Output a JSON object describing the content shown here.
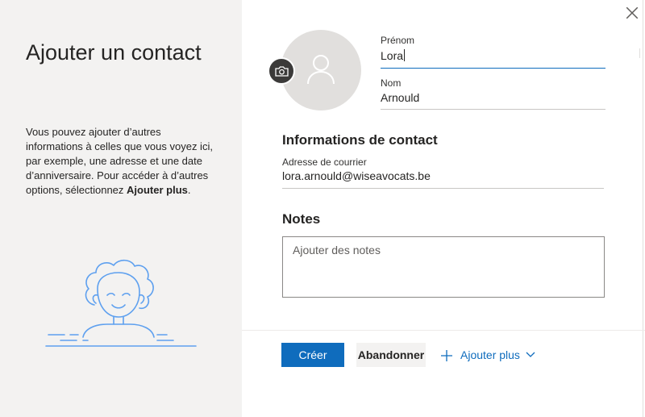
{
  "dialog": {
    "title": "Ajouter un contact",
    "description_text": "Vous pouvez ajouter d’autres informations à celles que vous voyez ici, par exemple, une adresse et une date d’anniversaire. Pour accéder à d’autres options, sélectionnez ",
    "description_bold": "Ajouter plus",
    "description_end": "."
  },
  "form": {
    "first_name": {
      "label": "Prénom",
      "value": "Lora"
    },
    "last_name": {
      "label": "Nom",
      "value": "Arnould"
    },
    "contact_section_title": "Informations de contact",
    "email": {
      "label": "Adresse de courrier",
      "value": "lora.arnould@wiseavocats.be"
    },
    "notes_section_title": "Notes",
    "notes": {
      "placeholder": "Ajouter des notes",
      "value": ""
    }
  },
  "actions": {
    "create": "Créer",
    "cancel": "Abandonner",
    "add_more": "Ajouter plus"
  },
  "icons": {
    "close": "close-icon",
    "camera": "camera-icon",
    "avatar": "person-icon",
    "add": "plus-icon",
    "expand": "chevron-down-icon"
  },
  "colors": {
    "accent": "#0f6cbd",
    "left_panel_bg": "#f3f2f1",
    "avatar_bg": "#e1dfdd",
    "illustration": "#5ea0ef"
  }
}
